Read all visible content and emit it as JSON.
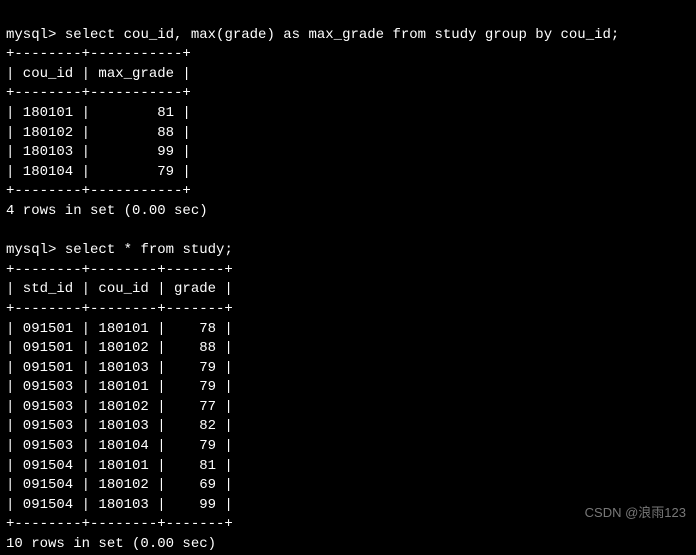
{
  "query1": {
    "prompt": "mysql>",
    "sql": "select cou_id, max(grade) as max_grade from study group by cou_id;"
  },
  "result1": {
    "sep": "+--------+-----------+",
    "header": "| cou_id | max_grade |",
    "rows": [
      "| 180101 |        81 |",
      "| 180102 |        88 |",
      "| 180103 |        99 |",
      "| 180104 |        79 |"
    ],
    "status": "4 rows in set (0.00 sec)"
  },
  "query2": {
    "prompt": "mysql>",
    "sql": "select * from study;"
  },
  "result2": {
    "sep": "+--------+--------+-------+",
    "header": "| std_id | cou_id | grade |",
    "rows": [
      "| 091501 | 180101 |    78 |",
      "| 091501 | 180102 |    88 |",
      "| 091501 | 180103 |    79 |",
      "| 091503 | 180101 |    79 |",
      "| 091503 | 180102 |    77 |",
      "| 091503 | 180103 |    82 |",
      "| 091503 | 180104 |    79 |",
      "| 091504 | 180101 |    81 |",
      "| 091504 | 180102 |    69 |",
      "| 091504 | 180103 |    99 |"
    ],
    "status": "10 rows in set (0.00 sec)"
  },
  "watermark": "CSDN @浪雨123",
  "chart_data": [
    {
      "type": "table",
      "title": "max_grade per cou_id",
      "columns": [
        "cou_id",
        "max_grade"
      ],
      "rows": [
        [
          "180101",
          81
        ],
        [
          "180102",
          88
        ],
        [
          "180103",
          99
        ],
        [
          "180104",
          79
        ]
      ]
    },
    {
      "type": "table",
      "title": "study",
      "columns": [
        "std_id",
        "cou_id",
        "grade"
      ],
      "rows": [
        [
          "091501",
          "180101",
          78
        ],
        [
          "091501",
          "180102",
          88
        ],
        [
          "091501",
          "180103",
          79
        ],
        [
          "091503",
          "180101",
          79
        ],
        [
          "091503",
          "180102",
          77
        ],
        [
          "091503",
          "180103",
          82
        ],
        [
          "091503",
          "180104",
          79
        ],
        [
          "091504",
          "180101",
          81
        ],
        [
          "091504",
          "180102",
          69
        ],
        [
          "091504",
          "180103",
          99
        ]
      ]
    }
  ]
}
